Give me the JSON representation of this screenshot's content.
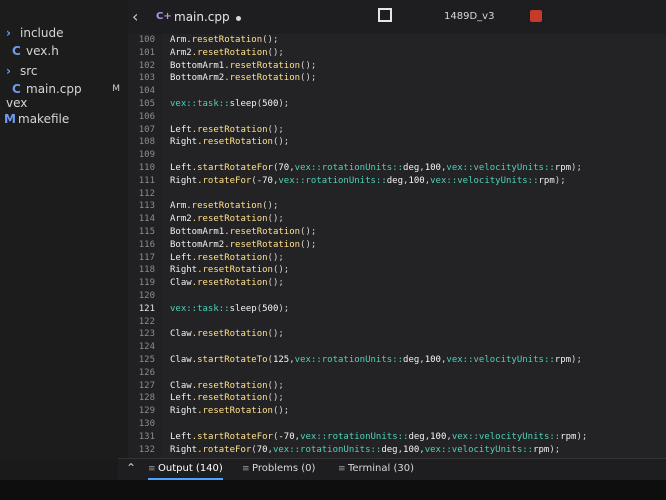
{
  "sidebar": {
    "items": [
      {
        "label": "include",
        "icon": "chevron-icon",
        "badge": ""
      },
      {
        "label": "vex.h",
        "icon": "cpp-file-icon",
        "badge": ""
      },
      {
        "label": "src",
        "icon": "chevron-icon",
        "badge": ""
      },
      {
        "label": "main.cpp",
        "icon": "cpp-file-icon",
        "badge": "M"
      },
      {
        "label": "vex",
        "icon": "",
        "badge": ""
      },
      {
        "label": "makefile",
        "icon": "makefile-icon",
        "badge": ""
      }
    ]
  },
  "topbar": {
    "back_icon": "back-arrow-icon",
    "tab_label": "main.cpp",
    "unsaved_dot": "modified-dot",
    "project_label": "1489D_v3"
  },
  "editor": {
    "lines": [
      {
        "num": "100",
        "code": "Arm.resetRotation();"
      },
      {
        "num": "101",
        "code": "Arm2.resetRotation();"
      },
      {
        "num": "102",
        "code": "BottomArm1.resetRotation();"
      },
      {
        "num": "103",
        "code": "BottomArm2.resetRotation();"
      },
      {
        "num": "104",
        "code": ""
      },
      {
        "num": "105",
        "code": "vex::task::sleep(500);"
      },
      {
        "num": "106",
        "code": ""
      },
      {
        "num": "107",
        "code": "Left.resetRotation();"
      },
      {
        "num": "108",
        "code": "Right.resetRotation();"
      },
      {
        "num": "109",
        "code": ""
      },
      {
        "num": "110",
        "code": "Left.startRotateFor(70,vex::rotationUnits::deg,100,vex::velocityUnits::rpm);"
      },
      {
        "num": "111",
        "code": "Right.rotateFor(-70,vex::rotationUnits::deg,100,vex::velocityUnits::rpm);"
      },
      {
        "num": "112",
        "code": ""
      },
      {
        "num": "113",
        "code": "Arm.resetRotation();"
      },
      {
        "num": "114",
        "code": "Arm2.resetRotation();"
      },
      {
        "num": "115",
        "code": "BottomArm1.resetRotation();"
      },
      {
        "num": "116",
        "code": "BottomArm2.resetRotation();"
      },
      {
        "num": "117",
        "code": "Left.resetRotation();"
      },
      {
        "num": "118",
        "code": "Right.resetRotation();"
      },
      {
        "num": "119",
        "code": "Claw.resetRotation();"
      },
      {
        "num": "120",
        "code": ""
      },
      {
        "num": "121",
        "code": "vex::task::sleep(500);"
      },
      {
        "num": "122",
        "code": ""
      },
      {
        "num": "123",
        "code": "Claw.resetRotation();"
      },
      {
        "num": "124",
        "code": ""
      },
      {
        "num": "125",
        "code": "Claw.startRotateTo(125,vex::rotationUnits::deg,100,vex::velocityUnits::rpm);"
      },
      {
        "num": "126",
        "code": ""
      },
      {
        "num": "127",
        "code": "Claw.resetRotation();"
      },
      {
        "num": "128",
        "code": "Left.resetRotation();"
      },
      {
        "num": "129",
        "code": "Right.resetRotation();"
      },
      {
        "num": "130",
        "code": ""
      },
      {
        "num": "131",
        "code": "Left.startRotateFor(-70,vex::rotationUnits::deg,100,vex::velocityUnits::rpm);"
      },
      {
        "num": "132",
        "code": "Right.rotateFor(70,vex::rotationUnits::deg,100,vex::velocityUnits::rpm);"
      }
    ],
    "active_line": "121"
  },
  "bottom_panel": {
    "tabs": [
      {
        "label": "Output (140)",
        "icon": "output-icon",
        "active": true
      },
      {
        "label": "Problems (0)",
        "icon": "problems-icon",
        "active": false
      },
      {
        "label": "Terminal (30)",
        "icon": "terminal-icon",
        "active": false
      }
    ]
  },
  "colors": {
    "method": "#ffe08a",
    "namespace": "#4fd0b8",
    "accent": "#4da3ff"
  }
}
